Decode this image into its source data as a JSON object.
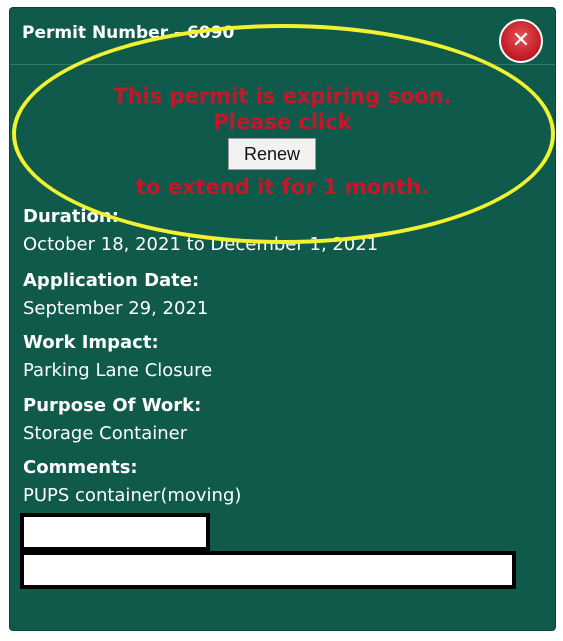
{
  "header": {
    "title": "Permit Number - 6090",
    "close_icon": "close-icon"
  },
  "renewal": {
    "line1": "This permit is expiring soon.",
    "line2": "Please click",
    "button": "Renew",
    "line3": "to extend it for 1 month."
  },
  "fields": {
    "duration_label": "Duration:",
    "duration_value": "October 18, 2021 to December 1, 2021",
    "application_date_label": "Application Date:",
    "application_date_value": "September 29, 2021",
    "work_impact_label": "Work Impact:",
    "work_impact_value": "Parking Lane Closure",
    "purpose_label": "Purpose Of Work:",
    "purpose_value": "Storage Container",
    "comments_label": "Comments:",
    "comments_value": "PUPS container(moving)"
  },
  "colors": {
    "panel": "#0f5a4a",
    "notice_text": "#c8152a",
    "highlight": "#f2f230",
    "close_button": "#c71f2a"
  }
}
